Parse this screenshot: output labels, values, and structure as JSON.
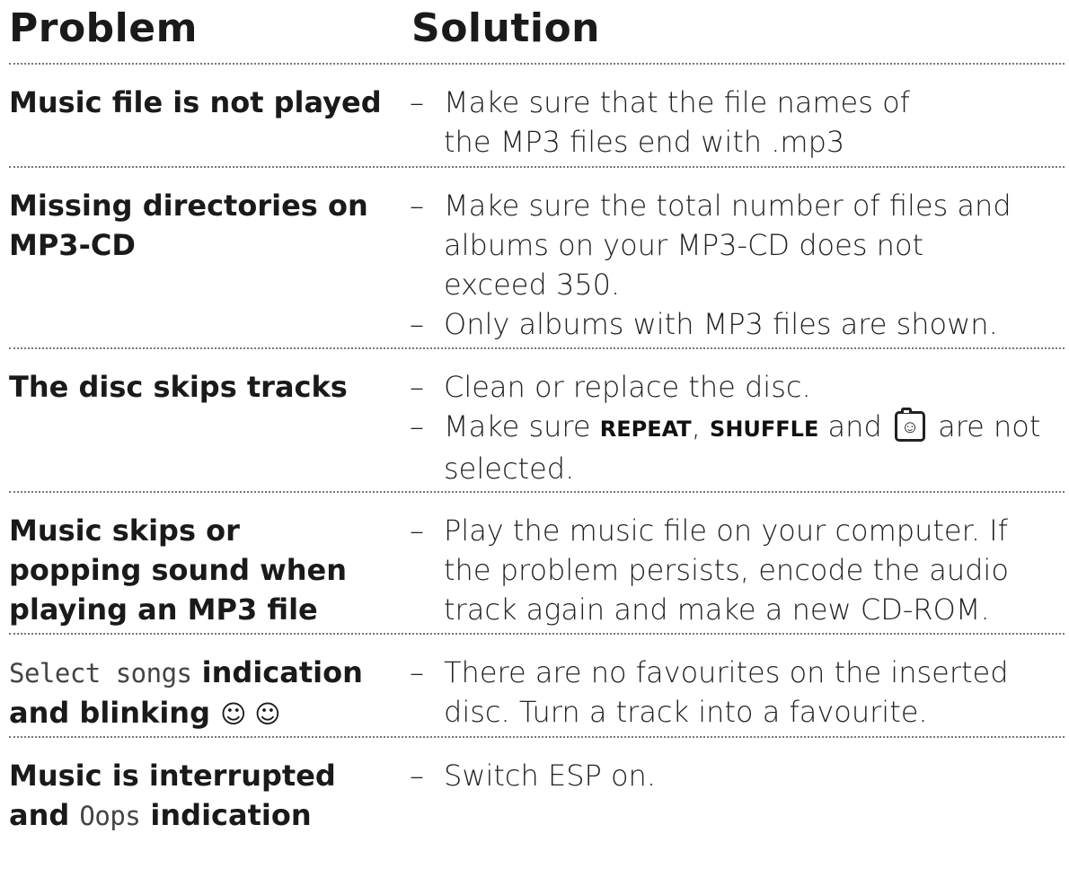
{
  "header": {
    "problem": "Problem",
    "solution": "Solution"
  },
  "rows": [
    {
      "problem": "Music file is not played",
      "solutions": [
        "Make sure that the file names of the MP3 files end with .mp3"
      ]
    },
    {
      "problem": "Missing directories on MP3-CD",
      "solutions": [
        "Make sure the total number of files and albums on your MP3-CD does not exceed 350.",
        "Only albums with MP3 files are shown."
      ]
    },
    {
      "problem": "The disc skips tracks",
      "solutions": [
        "Clean or replace the disc.",
        {
          "prefix": "Make sure ",
          "key1": "REPEAT",
          "sep": ", ",
          "key2": "SHUFFLE",
          "mid": " and ",
          "icon": "favourites-smiley-icon",
          "suffix": " are not selected."
        }
      ]
    },
    {
      "problem": "Music skips or popping sound when playing an MP3 file",
      "solutions": [
        "Play the music file on your computer. If the problem persists, encode the audio track again and make a new CD-ROM."
      ]
    },
    {
      "problem": {
        "display": "Select songs",
        "text1": " indication and blinking ",
        "smileys": "☺ ☺"
      },
      "solutions": [
        "There are no favourites on the inserted disc. Turn a track into a favourite."
      ]
    },
    {
      "problem": {
        "text1": "Music is interrupted and ",
        "display": "Oops",
        "text2": " indication"
      },
      "solutions": [
        "Switch ESP on."
      ]
    }
  ],
  "dash": "–",
  "icon_face": "☺"
}
